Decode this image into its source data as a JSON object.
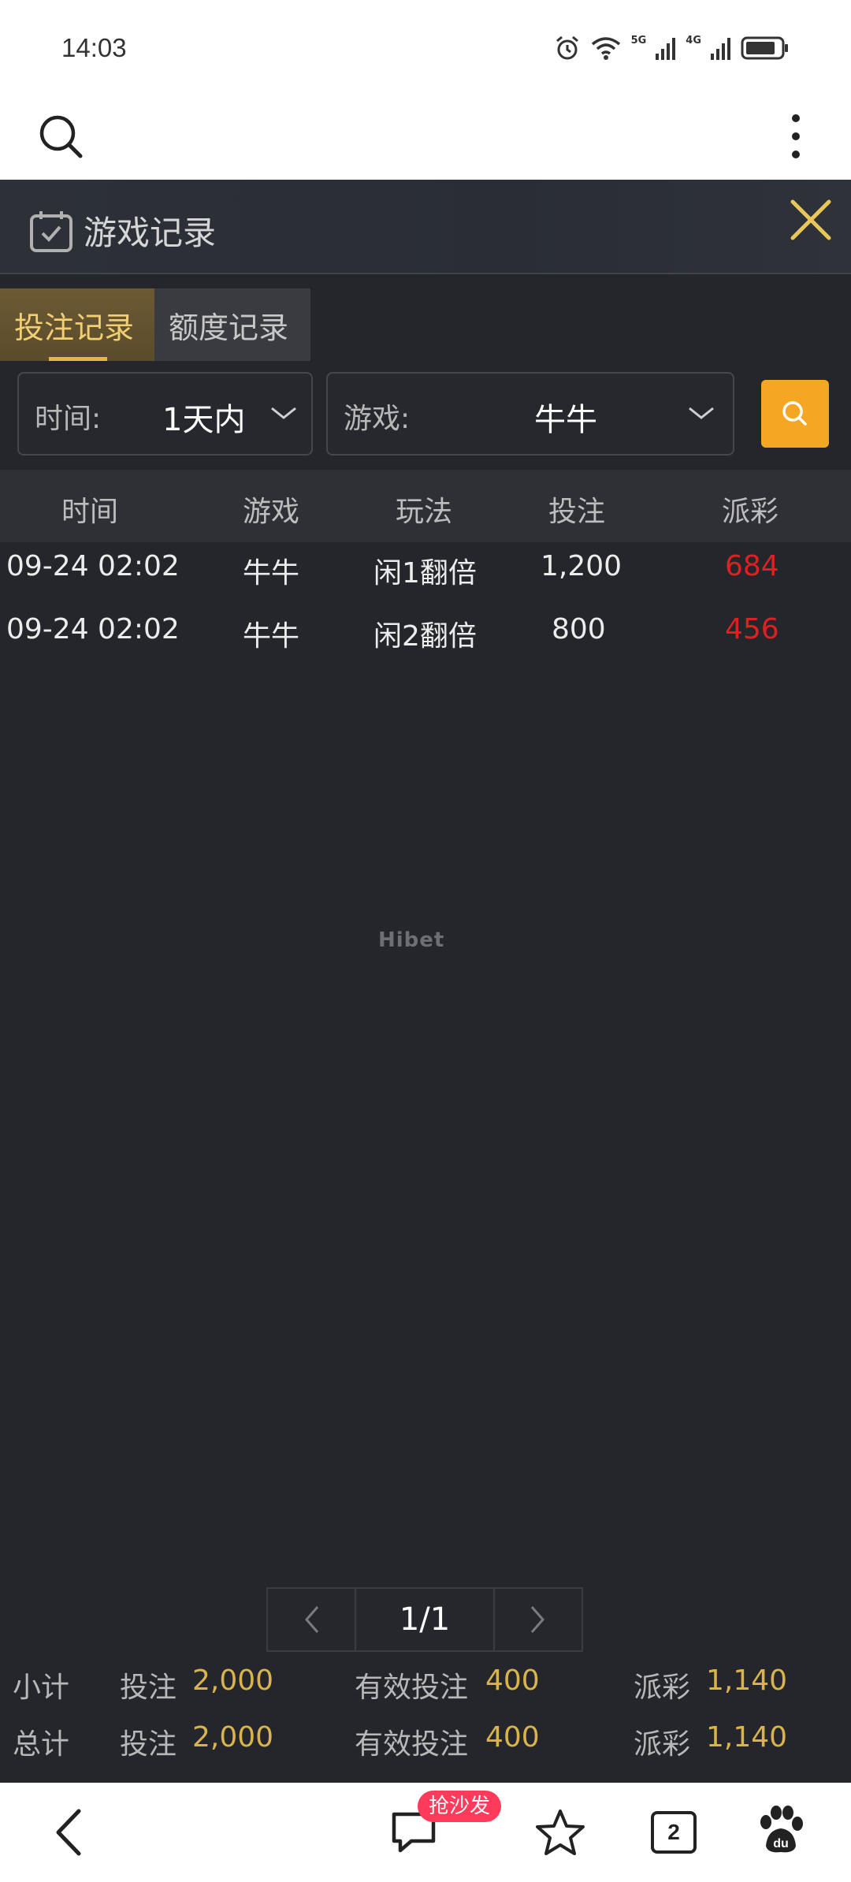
{
  "status_bar": {
    "time": "14:03",
    "net_5g": "5G",
    "net_4g": "4G"
  },
  "panel": {
    "title": "游戏记录",
    "tabs": [
      {
        "label": "投注记录",
        "active": true
      },
      {
        "label": "额度记录",
        "active": false
      }
    ],
    "filters": {
      "time_label": "时间:",
      "time_value": "1天内",
      "game_label": "游戏:",
      "game_value": "牛牛"
    },
    "table": {
      "headers": [
        "时间",
        "游戏",
        "玩法",
        "投注",
        "派彩"
      ],
      "rows": [
        {
          "time": "09-24 02:02",
          "game": "牛牛",
          "play": "闲1翻倍",
          "bet": "1,200",
          "payout": "684"
        },
        {
          "time": "09-24 02:02",
          "game": "牛牛",
          "play": "闲2翻倍",
          "bet": "800",
          "payout": "456"
        }
      ]
    },
    "watermark": "Hibet",
    "pager": {
      "current": "1/1"
    },
    "summary": [
      {
        "label": "小计",
        "bet_key": "投注",
        "bet": "2,000",
        "valid_key": "有效投注",
        "valid": "400",
        "payout_key": "派彩",
        "payout": "1,140"
      },
      {
        "label": "总计",
        "bet_key": "投注",
        "bet": "2,000",
        "valid_key": "有效投注",
        "valid": "400",
        "payout_key": "派彩",
        "payout": "1,140"
      }
    ]
  },
  "bottom_nav": {
    "badge": "抢沙发",
    "tab_count": "2"
  },
  "colors": {
    "accent": "#f5a623",
    "gold_text": "#d9b44a",
    "red_payout": "#e02020",
    "panel_bg": "#25262b"
  }
}
